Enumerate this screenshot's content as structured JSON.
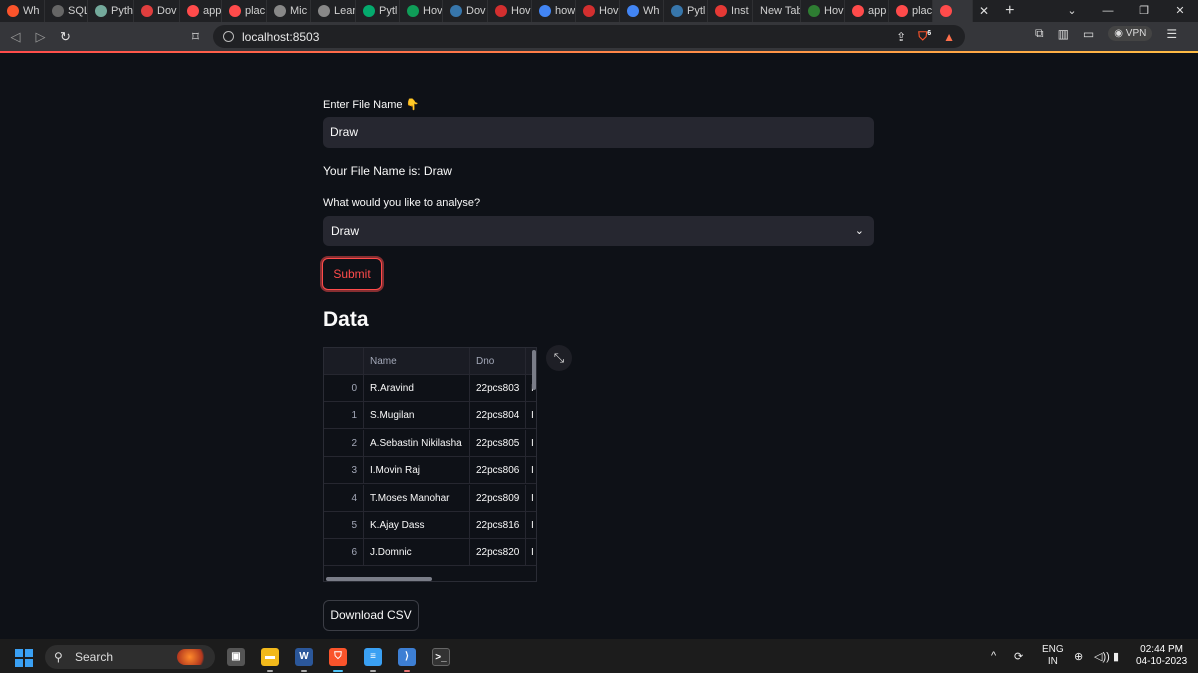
{
  "browser": {
    "tabs": [
      {
        "label": "Wh",
        "icon": "brave-icon",
        "color": "#fb542b"
      },
      {
        "label": "SQL",
        "icon": "sql-icon",
        "color": "#666666"
      },
      {
        "label": "Pyth",
        "icon": "chatgpt-icon",
        "color": "#74aa9c"
      },
      {
        "label": "Dov",
        "icon": "heart-icon",
        "color": "#e03e3e"
      },
      {
        "label": "app",
        "icon": "streamlit-icon",
        "color": "#ff4b4b"
      },
      {
        "label": "plac",
        "icon": "streamlit-icon",
        "color": "#ff4b4b"
      },
      {
        "label": "Mic",
        "icon": "globe-icon",
        "color": "#888888"
      },
      {
        "label": "Lear",
        "icon": "globe-icon",
        "color": "#888888"
      },
      {
        "label": "Pytl",
        "icon": "w3-icon",
        "color": "#04aa6d"
      },
      {
        "label": "Hov",
        "icon": "sheets-icon",
        "color": "#0f9d58"
      },
      {
        "label": "Dov",
        "icon": "python-icon",
        "color": "#3776ab"
      },
      {
        "label": "Hov",
        "icon": "v-icon",
        "color": "#d32f2f"
      },
      {
        "label": "how",
        "icon": "google-icon",
        "color": "#4285f4"
      },
      {
        "label": "Hov",
        "icon": "v-icon",
        "color": "#d32f2f"
      },
      {
        "label": "Wh",
        "icon": "google-icon",
        "color": "#4285f4"
      },
      {
        "label": "Pytl",
        "icon": "python-icon",
        "color": "#3776ab"
      },
      {
        "label": "Inst",
        "icon": "crown-icon",
        "color": "#e53935"
      },
      {
        "label": "New Tab",
        "icon": "",
        "color": "#202124"
      },
      {
        "label": "Hov",
        "icon": "infinity-icon",
        "color": "#2e7d32"
      },
      {
        "label": "app",
        "icon": "streamlit-icon",
        "color": "#ff4b4b"
      },
      {
        "label": "plac",
        "icon": "streamlit-icon",
        "color": "#ff4b4b"
      },
      {
        "label": "",
        "icon": "streamlit-icon",
        "color": "#ff4b4b"
      }
    ],
    "url": "localhost:8503",
    "vpn_label": "VPN",
    "shield_count": "6"
  },
  "app": {
    "file_label": "Enter File Name 👇",
    "file_value": "Draw",
    "file_message": "Your File Name is: Draw",
    "analyse_label": "What would you like to analyse?",
    "analyse_value": "Draw",
    "submit_label": "Submit",
    "heading": "Data",
    "download_label": "Download CSV"
  },
  "table": {
    "columns": [
      "",
      "Name",
      "Dno",
      ""
    ],
    "rows": [
      {
        "idx": "0",
        "name": "R.Aravind",
        "dno": "22pcs803",
        "more": "I"
      },
      {
        "idx": "1",
        "name": "S.Mugilan",
        "dno": "22pcs804",
        "more": "I"
      },
      {
        "idx": "2",
        "name": "A.Sebastin Nikilasha",
        "dno": "22pcs805",
        "more": "I"
      },
      {
        "idx": "3",
        "name": "I.Movin Raj",
        "dno": "22pcs806",
        "more": "I"
      },
      {
        "idx": "4",
        "name": "T.Moses Manohar",
        "dno": "22pcs809",
        "more": "I"
      },
      {
        "idx": "5",
        "name": "K.Ajay Dass",
        "dno": "22pcs816",
        "more": "I"
      },
      {
        "idx": "6",
        "name": "J.Domnic",
        "dno": "22pcs820",
        "more": "I"
      }
    ]
  },
  "taskbar": {
    "search_label": "Search",
    "lang_top": "ENG",
    "lang_bottom": "IN",
    "time": "02:44 PM",
    "date": "04-10-2023"
  }
}
